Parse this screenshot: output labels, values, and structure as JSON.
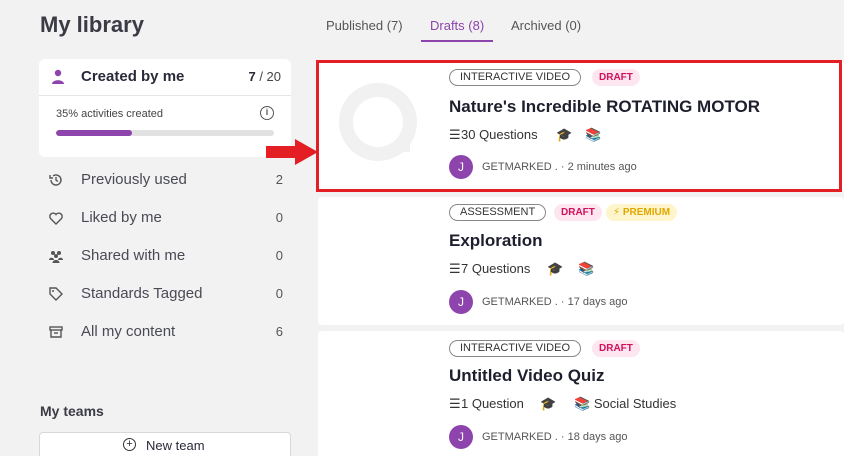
{
  "sidebar": {
    "title": "My library",
    "created": {
      "label": "Created by me",
      "count_current": "7",
      "count_total": " / 20",
      "progress_text": "35% activities created",
      "progress_fraction": 0.35
    },
    "items": [
      {
        "label": "Previously used",
        "count": "2",
        "icon": "history-icon"
      },
      {
        "label": "Liked by me",
        "count": "0",
        "icon": "heart-icon"
      },
      {
        "label": "Shared with me",
        "count": "0",
        "icon": "people-icon"
      },
      {
        "label": "Standards Tagged",
        "count": "0",
        "icon": "tag-icon"
      },
      {
        "label": "All my content",
        "count": "6",
        "icon": "archive-icon"
      }
    ],
    "teams_title": "My teams",
    "new_team_label": "New team"
  },
  "tabs": [
    {
      "label": "Published (7)",
      "active": false
    },
    {
      "label": "Drafts (8)",
      "active": true
    },
    {
      "label": "Archived (0)",
      "active": false
    }
  ],
  "activities": [
    {
      "type": "INTERACTIVE VIDEO",
      "status": "DRAFT",
      "title": "Nature's Incredible ROTATING MOTOR",
      "questions": "30 Questions",
      "subject": "",
      "author": "GETMARKED .",
      "avatar_letter": "J",
      "time": "2 minutes ago"
    },
    {
      "type": "ASSESSMENT",
      "status": "DRAFT",
      "badge": "PREMIUM",
      "title": "Exploration",
      "questions": "7 Questions",
      "subject": "",
      "author": "GETMARKED .",
      "avatar_letter": "J",
      "time": "17 days ago"
    },
    {
      "type": "INTERACTIVE VIDEO",
      "status": "DRAFT",
      "title": "Untitled Video Quiz",
      "questions": "1 Question",
      "subject": "Social Studies",
      "author": "GETMARKED .",
      "avatar_letter": "J",
      "time": "18 days ago"
    }
  ],
  "separator": "·",
  "colors": {
    "accent": "#8e44ad",
    "highlight": "#e31e24",
    "draft": "#d0115d",
    "premium": "#e0a800"
  }
}
